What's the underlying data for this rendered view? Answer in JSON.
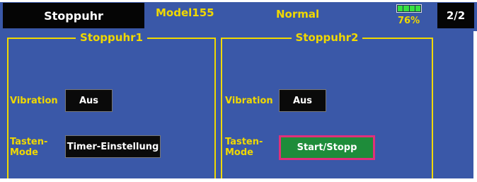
{
  "header": {
    "title": "Stoppuhr",
    "model": "Model155",
    "mode": "Normal",
    "battery_percent": "76%",
    "battery_level": 0.76,
    "page": "2/2"
  },
  "panels": [
    {
      "title": "Stoppuhr1",
      "vibration_label": "Vibration",
      "vibration_value": "Aus",
      "key_mode_label_line1": "Tasten-",
      "key_mode_label_line2": "Mode",
      "key_mode_value": "Timer-Einstellung"
    },
    {
      "title": "Stoppuhr2",
      "vibration_label": "Vibration",
      "vibration_value": "Aus",
      "key_mode_label_line1": "Tasten-",
      "key_mode_label_line2": "Mode",
      "key_mode_value": "Start/Stopp"
    }
  ],
  "colors": {
    "background": "#3a58a8",
    "accent": "#f0d800",
    "button": "#0a0a0a",
    "active_button": "#1e8c3a",
    "active_border": "#e0307a"
  }
}
